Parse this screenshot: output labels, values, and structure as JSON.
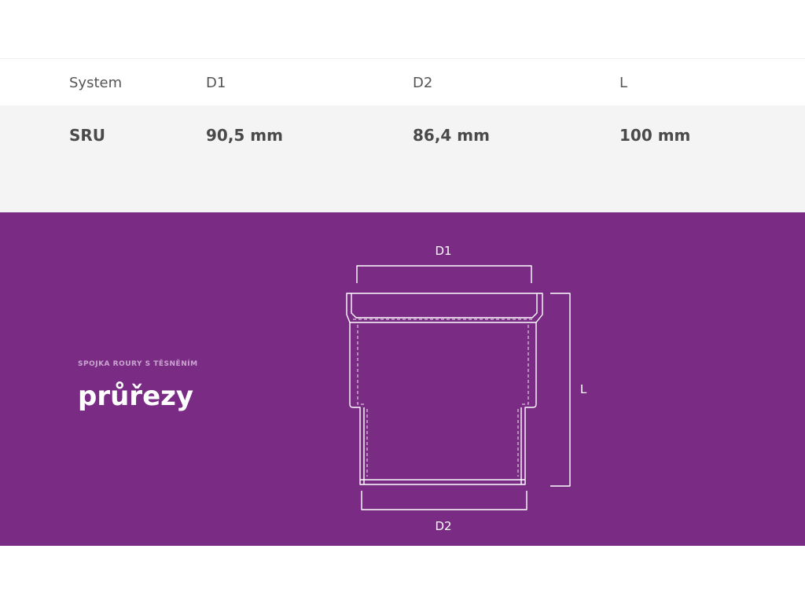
{
  "table": {
    "headers": [
      "System",
      "D1",
      "D2",
      "L"
    ],
    "rows": [
      [
        "SRU",
        "90,5 mm",
        "86,4 mm",
        "100 mm"
      ]
    ]
  },
  "section": {
    "eyebrow": "SPOJKA ROURY S TĚSNĚNÍM",
    "heading": "průřezy",
    "background_color": "#7a2c85"
  },
  "drawing": {
    "label_d1": "D1",
    "label_d2": "D2",
    "label_l": "L"
  }
}
